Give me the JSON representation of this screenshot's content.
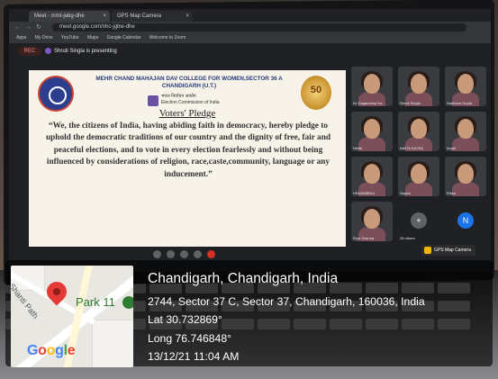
{
  "browser": {
    "tabs": [
      {
        "label": "Meet - mmt-jabg-dhe"
      },
      {
        "label": "GPS Map Camera"
      }
    ],
    "url": "meet.google.com/nhc-jgbw-dhe",
    "bookmarks": [
      "Apps",
      "My Drive",
      "YouTube",
      "Maps",
      "Google Calendar",
      "Welcome to Zoom"
    ]
  },
  "meet": {
    "rec_label": "REC",
    "presenting_text": "Shruti Singla is presenting"
  },
  "slide": {
    "college_line1": "MEHR CHAND MAHAJAN DAV COLLEGE FOR WOMEN,SECTOR 36 A",
    "college_line2": "CHANDIGARH (U.T.)",
    "logo_right_text": "50",
    "eci_hindi": "भारत निर्वाचन आयोग",
    "eci_english": "Election Commission of India",
    "title": "Voters' Pledge",
    "pledge": "“We, the citizens of India, having abiding faith in democracy, hereby pledge to uphold the democratic traditions of our country and the dignity of free, fair and peaceful elections, and to vote in every election fearlessly and without being influenced by considerations of religion, race,caste,community, language or any inducement.”"
  },
  "participants": [
    {
      "name": "Dr Gagandeep Ka..."
    },
    {
      "name": "Shruti Singla"
    },
    {
      "name": "Sadhana Gupta"
    },
    {
      "name": "Nikita"
    },
    {
      "name": "AMITA KAYRA"
    },
    {
      "name": "Anjali"
    },
    {
      "name": "HEMAMBIKA"
    },
    {
      "name": "Sapna"
    },
    {
      "name": "Ritika"
    },
    {
      "name": "Riya Sharma"
    },
    {
      "name": "28 others"
    },
    {
      "name": "N"
    }
  ],
  "gps_badge": "GPS Map Camera",
  "map": {
    "street": "Shanti Path",
    "place": "Park 11",
    "brand": "Google",
    "brand_colors": [
      "#4285F4",
      "#EA4335",
      "#FBBC05",
      "#4285F4",
      "#34A853",
      "#EA4335"
    ]
  },
  "location": {
    "title": "Chandigarh, Chandigarh, India",
    "address": "2744, Sector 37 C, Sector 37, Chandigarh, 160036, India",
    "lat": "Lat 30.732869°",
    "long": "Long 76.746848°",
    "datetime": "13/12/21 11:04 AM"
  }
}
